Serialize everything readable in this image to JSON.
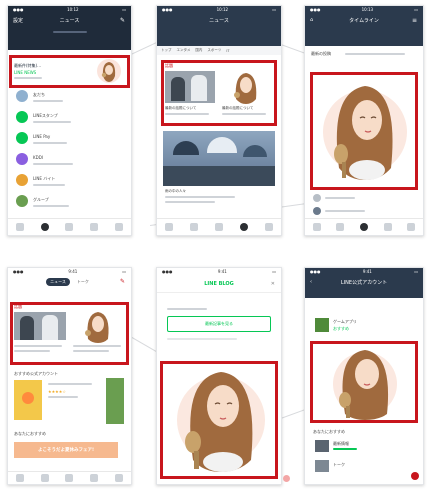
{
  "colors": {
    "highlight": "#c8161d",
    "line_green": "#06c755",
    "header_dark": "#1f2b3a",
    "header_mid": "#2b3a4d",
    "background_line": "#d8dadd"
  },
  "phones": [
    {
      "status_time": "10:12",
      "nav_title": "ニュース",
      "nav_left": "設定",
      "nav_right_icon": "compose-icon",
      "top_item_title": "最新件(特集)…",
      "top_item_sub": "LINE NEWS",
      "list_items": [
        {
          "name": "友だち"
        },
        {
          "name": "LINEスタンプ"
        },
        {
          "name": "LINE Pay"
        },
        {
          "name": "KDDI"
        },
        {
          "name": "LINE バイト"
        },
        {
          "name": "グループ"
        }
      ]
    },
    {
      "status_time": "10:12",
      "nav_title": "ニュース",
      "tabs": [
        "トップ",
        "エンタメ",
        "国内",
        "スポーツ",
        "IT"
      ],
      "section_title": "話題",
      "article_1": "最新の話題について",
      "article_2": "最新の話題について",
      "photo_caption": "雨の中の人々"
    },
    {
      "status_time": "10:13",
      "nav_title": "タイムライン",
      "subtitle": "最新の投稿"
    },
    {
      "status_time": "9:41",
      "search_tabs": [
        "ニュース",
        "トーク"
      ],
      "section_title": "話題",
      "block_title": "おすすめ公式アカウント",
      "block_title_2": "あなたにおすすめ",
      "banner_text": "よこそうだよ夏休みフェア!"
    },
    {
      "status_time": "9:41",
      "logo": "LINE BLOG",
      "button_label": "最新記事を見る"
    },
    {
      "status_time": "9:41",
      "nav_title": "LINE公式アカウント",
      "item_1": "ゲームアプリ",
      "item_2": "おすすめ",
      "section_title": "あなたにおすすめ",
      "item_3": "最新情報",
      "item_4": "トーク"
    }
  ]
}
